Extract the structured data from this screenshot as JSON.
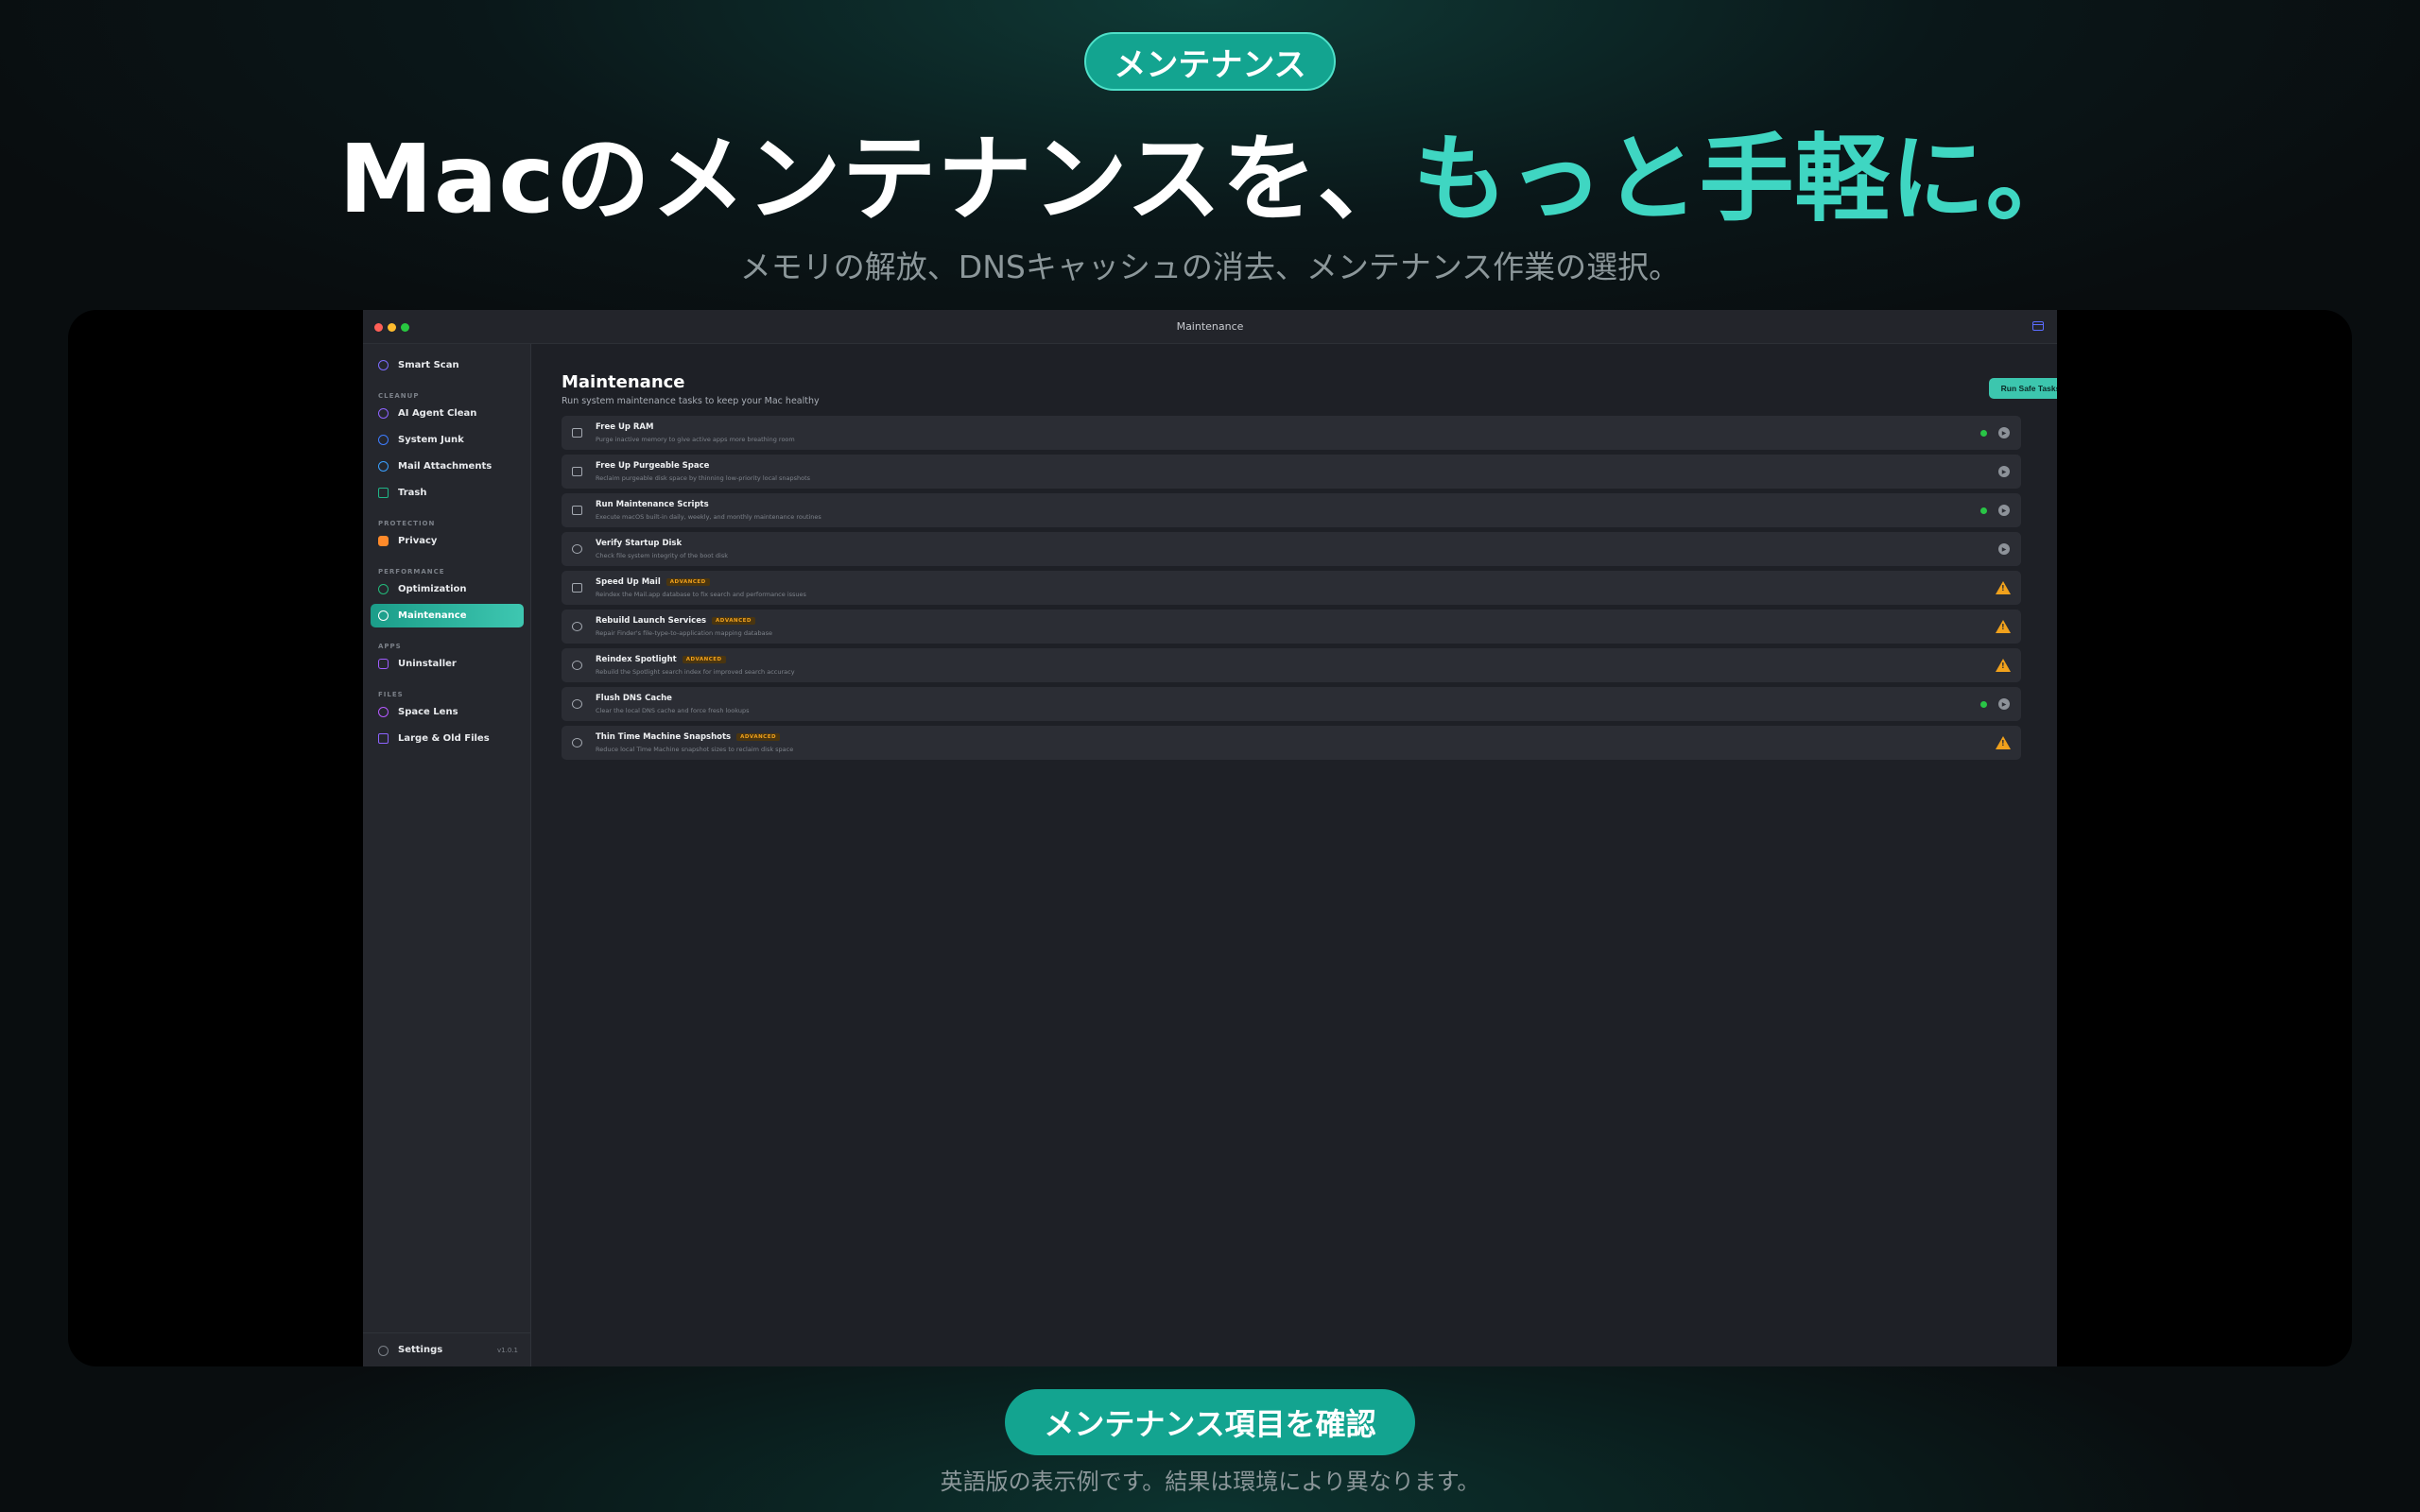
{
  "hero": {
    "pill_label": "メンテナンス",
    "headline_main": "Macのメンテナンスを、",
    "headline_accent": "もっと手軽に。",
    "subheadline": "メモリの解放、DNSキャッシュの消去、メンテナンス作業の選択。"
  },
  "window": {
    "title": "Maintenance"
  },
  "sidebar": {
    "smart_scan": "Smart Scan",
    "sections": {
      "cleanup": "CLEANUP",
      "protection": "PROTECTION",
      "performance": "PERFORMANCE",
      "apps": "APPS",
      "files": "FILES"
    },
    "items": {
      "ai_agent_clean": "AI Agent Clean",
      "system_junk": "System Junk",
      "mail_attachments": "Mail Attachments",
      "trash": "Trash",
      "privacy": "Privacy",
      "optimization": "Optimization",
      "maintenance": "Maintenance",
      "uninstaller": "Uninstaller",
      "space_lens": "Space Lens",
      "large_old_files": "Large & Old Files"
    },
    "settings": "Settings",
    "version": "v1.0.1"
  },
  "main": {
    "title": "Maintenance",
    "subtitle": "Run system maintenance tasks to keep your Mac healthy",
    "run_button": "Run Safe Tasks",
    "advanced_badge": "ADVANCED",
    "tasks": [
      {
        "name": "Free Up RAM",
        "desc": "Purge inactive memory to give active apps more breathing room"
      },
      {
        "name": "Free Up Purgeable Space",
        "desc": "Reclaim purgeable disk space by thinning low-priority local snapshots"
      },
      {
        "name": "Run Maintenance Scripts",
        "desc": "Execute macOS built-in daily, weekly, and monthly maintenance routines"
      },
      {
        "name": "Verify Startup Disk",
        "desc": "Check file system integrity of the boot disk"
      },
      {
        "name": "Speed Up Mail",
        "desc": "Reindex the Mail.app database to fix search and performance issues"
      },
      {
        "name": "Rebuild Launch Services",
        "desc": "Repair Finder's file-type-to-application mapping database"
      },
      {
        "name": "Reindex Spotlight",
        "desc": "Rebuild the Spotlight search index for improved search accuracy"
      },
      {
        "name": "Flush DNS Cache",
        "desc": "Clear the local DNS cache and force fresh lookups"
      },
      {
        "name": "Thin Time Machine Snapshots",
        "desc": "Reduce local Time Machine snapshot sizes to reclaim disk space"
      }
    ]
  },
  "cta": {
    "button": "メンテナンス項目を確認",
    "footnote": "英語版の表示例です。結果は環境により異なります。"
  },
  "colors": {
    "accent": "#3fd6c2",
    "button": "#13a490",
    "warning": "#f0a11c",
    "status_ok": "#29c546"
  }
}
